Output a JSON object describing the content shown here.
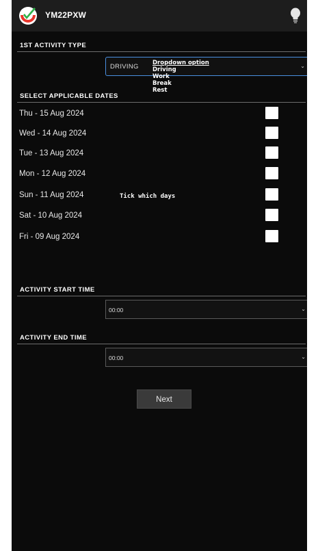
{
  "header": {
    "title": "YM22PXW",
    "logo_icon": "checkmark-logo-icon",
    "bulb_icon": "lightbulb-icon"
  },
  "activity_type": {
    "section_label": "1ST ACTIVITY TYPE",
    "selected_value": "DRIVING",
    "dropdown_header": "Dropdown option",
    "options": [
      "Driving",
      "Work",
      "Break",
      "Rest"
    ]
  },
  "dates": {
    "section_label": "SELECT APPLICABLE DATES",
    "hint": "Tick which days",
    "items": [
      {
        "label": "Thu - 15 Aug 2024",
        "checked": false
      },
      {
        "label": "Wed - 14 Aug 2024",
        "checked": false
      },
      {
        "label": "Tue - 13 Aug 2024",
        "checked": false
      },
      {
        "label": "Mon - 12 Aug 2024",
        "checked": false
      },
      {
        "label": "Sun - 11 Aug 2024",
        "checked": false
      },
      {
        "label": "Sat - 10 Aug 2024",
        "checked": false
      },
      {
        "label": "Fri - 09 Aug 2024",
        "checked": false
      }
    ]
  },
  "start_time": {
    "section_label": "ACTIVITY START TIME",
    "value": "00:00"
  },
  "end_time": {
    "section_label": "ACTIVITY END TIME",
    "value": "00:00"
  },
  "actions": {
    "next_label": "Next"
  },
  "colors": {
    "background": "#0b0b0b",
    "header": "#1d1d1d",
    "focus_border": "#4a90e2",
    "logo_green": "#2fb24a",
    "logo_red": "#e8352b"
  }
}
